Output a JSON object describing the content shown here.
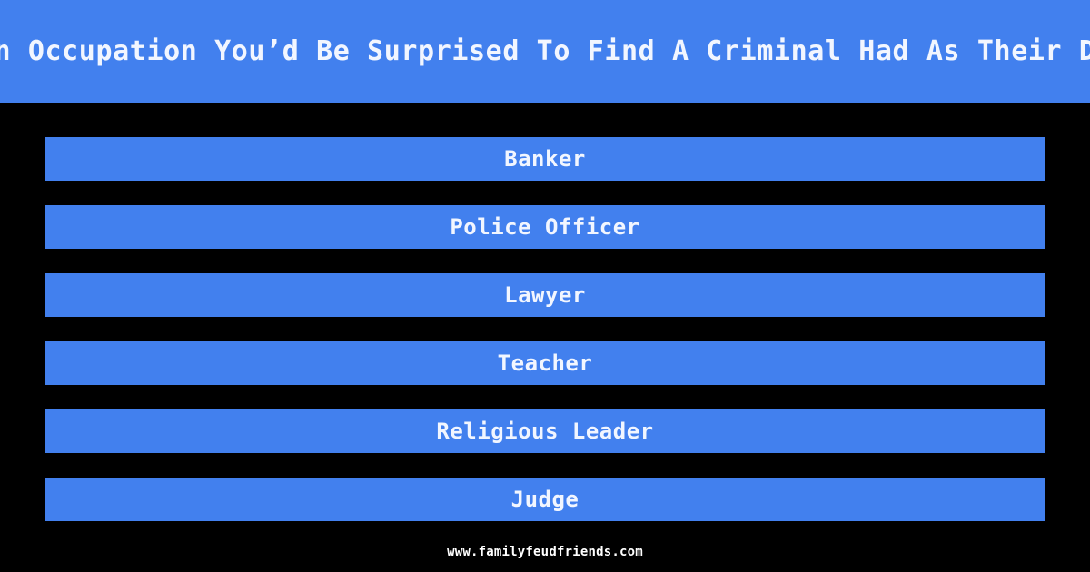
{
  "theme": {
    "background_color": "#000000",
    "accent_color": "#4280ee",
    "text_color": "#f2f6ff",
    "footer_text_color": "#ffffff"
  },
  "header": {
    "title": "Name An Occupation You’d Be Surprised To Find A Criminal Had As Their Day Job"
  },
  "answers": {
    "count": 6,
    "items": [
      {
        "rank": 1,
        "label": "Banker"
      },
      {
        "rank": 2,
        "label": "Police Officer"
      },
      {
        "rank": 3,
        "label": "Lawyer"
      },
      {
        "rank": 4,
        "label": "Teacher"
      },
      {
        "rank": 5,
        "label": "Religious Leader"
      },
      {
        "rank": 6,
        "label": "Judge"
      }
    ]
  },
  "footer": {
    "site": "www.familyfeudfriends.com"
  }
}
